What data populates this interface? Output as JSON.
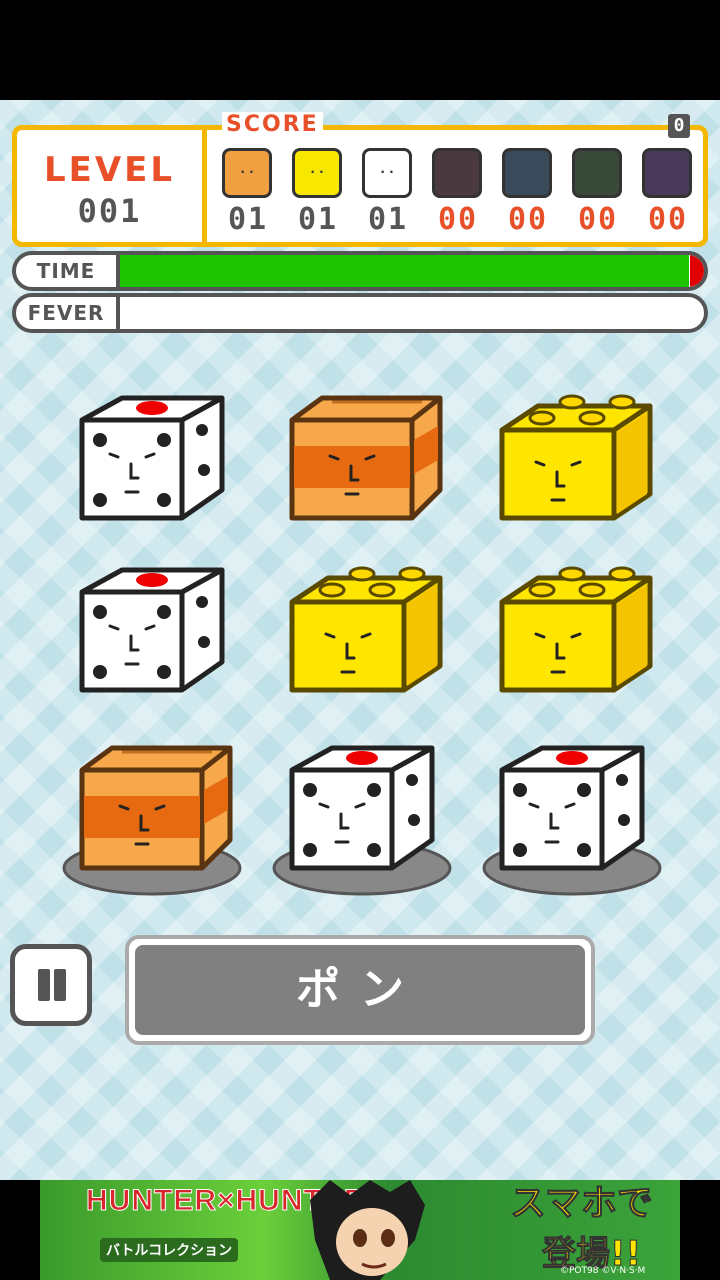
{
  "level": {
    "label": "LEVEL",
    "value": "001"
  },
  "score": {
    "label": "SCORE",
    "total": "0",
    "items": [
      {
        "name": "box",
        "count": "01",
        "color": "#f0a040",
        "active": true
      },
      {
        "name": "brick",
        "count": "01",
        "color": "#f8e800",
        "active": true
      },
      {
        "name": "dice",
        "count": "01",
        "color": "#ffffff",
        "active": true
      },
      {
        "name": "red",
        "count": "00",
        "color": "#4a3a40",
        "active": false
      },
      {
        "name": "blue",
        "count": "00",
        "color": "#3a4a5a",
        "active": false
      },
      {
        "name": "green",
        "count": "00",
        "color": "#3a4a3a",
        "active": false
      },
      {
        "name": "purple",
        "count": "00",
        "color": "#4a3a5a",
        "active": false
      }
    ],
    "active_count_color": "#555555",
    "inactive_count_color": "#e8502a"
  },
  "time": {
    "label": "TIME",
    "fraction": 0.975
  },
  "fever": {
    "label": "FEVER",
    "fraction": 0.0
  },
  "grid": [
    [
      "dice",
      "box",
      "brick"
    ],
    [
      "dice",
      "brick",
      "brick"
    ],
    [
      "box",
      "dice",
      "dice"
    ]
  ],
  "controls": {
    "pause_icon": "pause-icon",
    "pon_label": "ポン"
  },
  "banner": {
    "title": "HUNTER×HUNTER",
    "subtitle": "バトルコレクション",
    "cta_line1": "スマホで",
    "cta_line2": "登場!!",
    "copyright": "©POT98 ©V·N·S·M"
  }
}
